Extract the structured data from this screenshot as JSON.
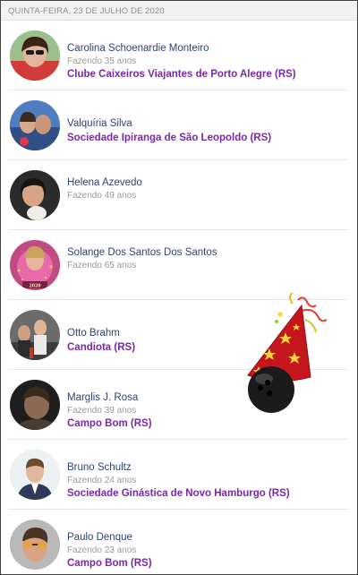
{
  "header": {
    "date": "QUINTA-FEIRA, 23 DE JULHO DE 2020"
  },
  "birthdays": [
    {
      "name": "Carolina Schoenardie Monteiro",
      "age": "Fazendo 35 anos",
      "club": "Clube Caixeiros Viajantes de Porto Alegre (RS)"
    },
    {
      "name": "Valquíria Silva",
      "age": "",
      "club": "Sociedade Ipiranga de São Leopoldo (RS)"
    },
    {
      "name": "Helena Azevedo",
      "age": "Fazendo 49 anos",
      "club": ""
    },
    {
      "name": "Solange Dos Santos Dos Santos",
      "age": "Fazendo 65 anos",
      "club": ""
    },
    {
      "name": "Otto Brahm",
      "age": "",
      "club": "Candiota (RS)"
    },
    {
      "name": "Marglis J. Rosa",
      "age": "Fazendo 39 anos",
      "club": "Campo Bom (RS)"
    },
    {
      "name": "Bruno Schultz",
      "age": "Fazendo 24 anos",
      "club": "Sociedade Ginástica de Novo Hamburgo (RS)"
    },
    {
      "name": "Paulo Denque",
      "age": "Fazendo 23 anos",
      "club": "Campo Bom (RS)"
    }
  ],
  "avatar_badge": {
    "text": "2020"
  },
  "decoration": {
    "icon": "party-hat-bowling-ball-icon"
  },
  "colors": {
    "name": "#2d4373",
    "club": "#7a28a8",
    "age": "#999999",
    "header_bg": "#f2f2f2"
  }
}
